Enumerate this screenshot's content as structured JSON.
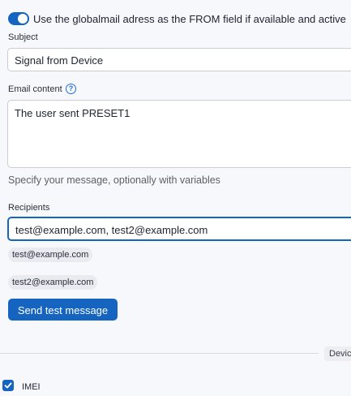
{
  "settings": {
    "globalmail_toggle_label": "Use the globalmail adress as the FROM field if available and active",
    "globalmail_toggle_on": true
  },
  "subject": {
    "label": "Subject",
    "value": "Signal from Device"
  },
  "email_content": {
    "label": "Email content",
    "help_icon": "question-circle-icon",
    "help_glyph": "?",
    "value": "The user sent PRESET1",
    "hint": "Specify your message, optionally with variables"
  },
  "recipients": {
    "label": "Recipients",
    "value": "test@example.com, test2@example.com",
    "chips": [
      "test@example.com",
      "test2@example.com"
    ]
  },
  "actions": {
    "send_test_label": "Send test message"
  },
  "device_section": {
    "tag_label": "Device",
    "fields": [
      {
        "label": "IMEI",
        "checked": true
      }
    ]
  },
  "colors": {
    "accent": "#1565c0",
    "background": "#f7f8fc"
  }
}
